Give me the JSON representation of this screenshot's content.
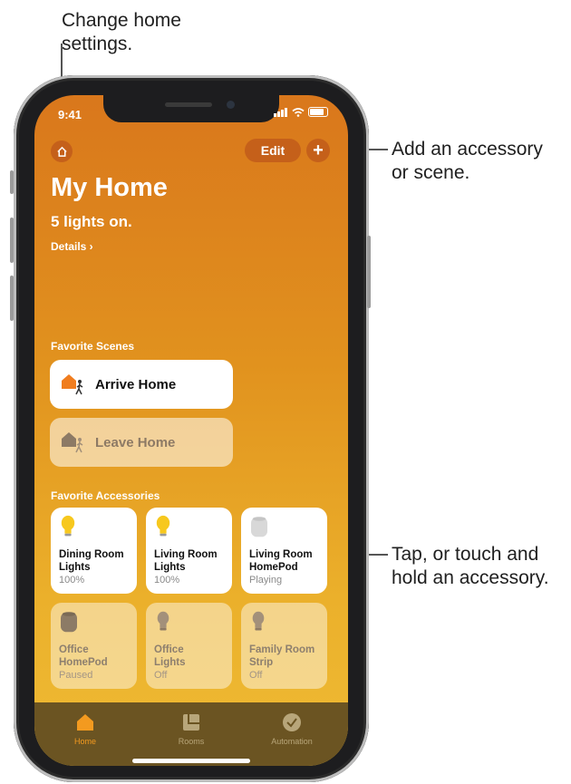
{
  "callouts": {
    "top": "Change home settings.",
    "top_line1": "Change home",
    "top_line2": "settings.",
    "add_line1": "Add an accessory",
    "add_line2": "or scene.",
    "tap_line1": "Tap, or touch and",
    "tap_line2": "hold an accessory."
  },
  "status_bar": {
    "time": "9:41"
  },
  "header": {
    "edit_label": "Edit",
    "add_label": "+",
    "title": "My Home",
    "subtitle": "5 lights on.",
    "details_link": "Details ›"
  },
  "sections": {
    "scenes": "Favorite Scenes",
    "accessories": "Favorite Accessories"
  },
  "scenes": [
    {
      "label": "Arrive Home",
      "active": true
    },
    {
      "label": "Leave Home",
      "active": false
    }
  ],
  "accessories": [
    {
      "name_line1": "Dining Room",
      "name_line2": "Lights",
      "status": "100%",
      "on": true,
      "icon": "lightbulb-icon"
    },
    {
      "name_line1": "Living Room",
      "name_line2": "Lights",
      "status": "100%",
      "on": true,
      "icon": "lightbulb-icon"
    },
    {
      "name_line1": "Living Room",
      "name_line2": "HomePod",
      "status": "Playing",
      "on": true,
      "icon": "homepod-icon"
    },
    {
      "name_line1": "Office",
      "name_line2": "HomePod",
      "status": "Paused",
      "on": false,
      "icon": "homepod-icon"
    },
    {
      "name_line1": "Office",
      "name_line2": "Lights",
      "status": "Off",
      "on": false,
      "icon": "lightbulb-icon"
    },
    {
      "name_line1": "Family Room",
      "name_line2": "Strip",
      "status": "Off",
      "on": false,
      "icon": "lightbulb-icon"
    }
  ],
  "tabs": [
    {
      "label": "Home",
      "selected": true
    },
    {
      "label": "Rooms",
      "selected": false
    },
    {
      "label": "Automation",
      "selected": false
    }
  ],
  "colors": {
    "accent": "#c5601a",
    "bulb_on": "#f7c81e",
    "tab_selected": "#f39a1f",
    "tab_unselected": "#b8a67a"
  }
}
